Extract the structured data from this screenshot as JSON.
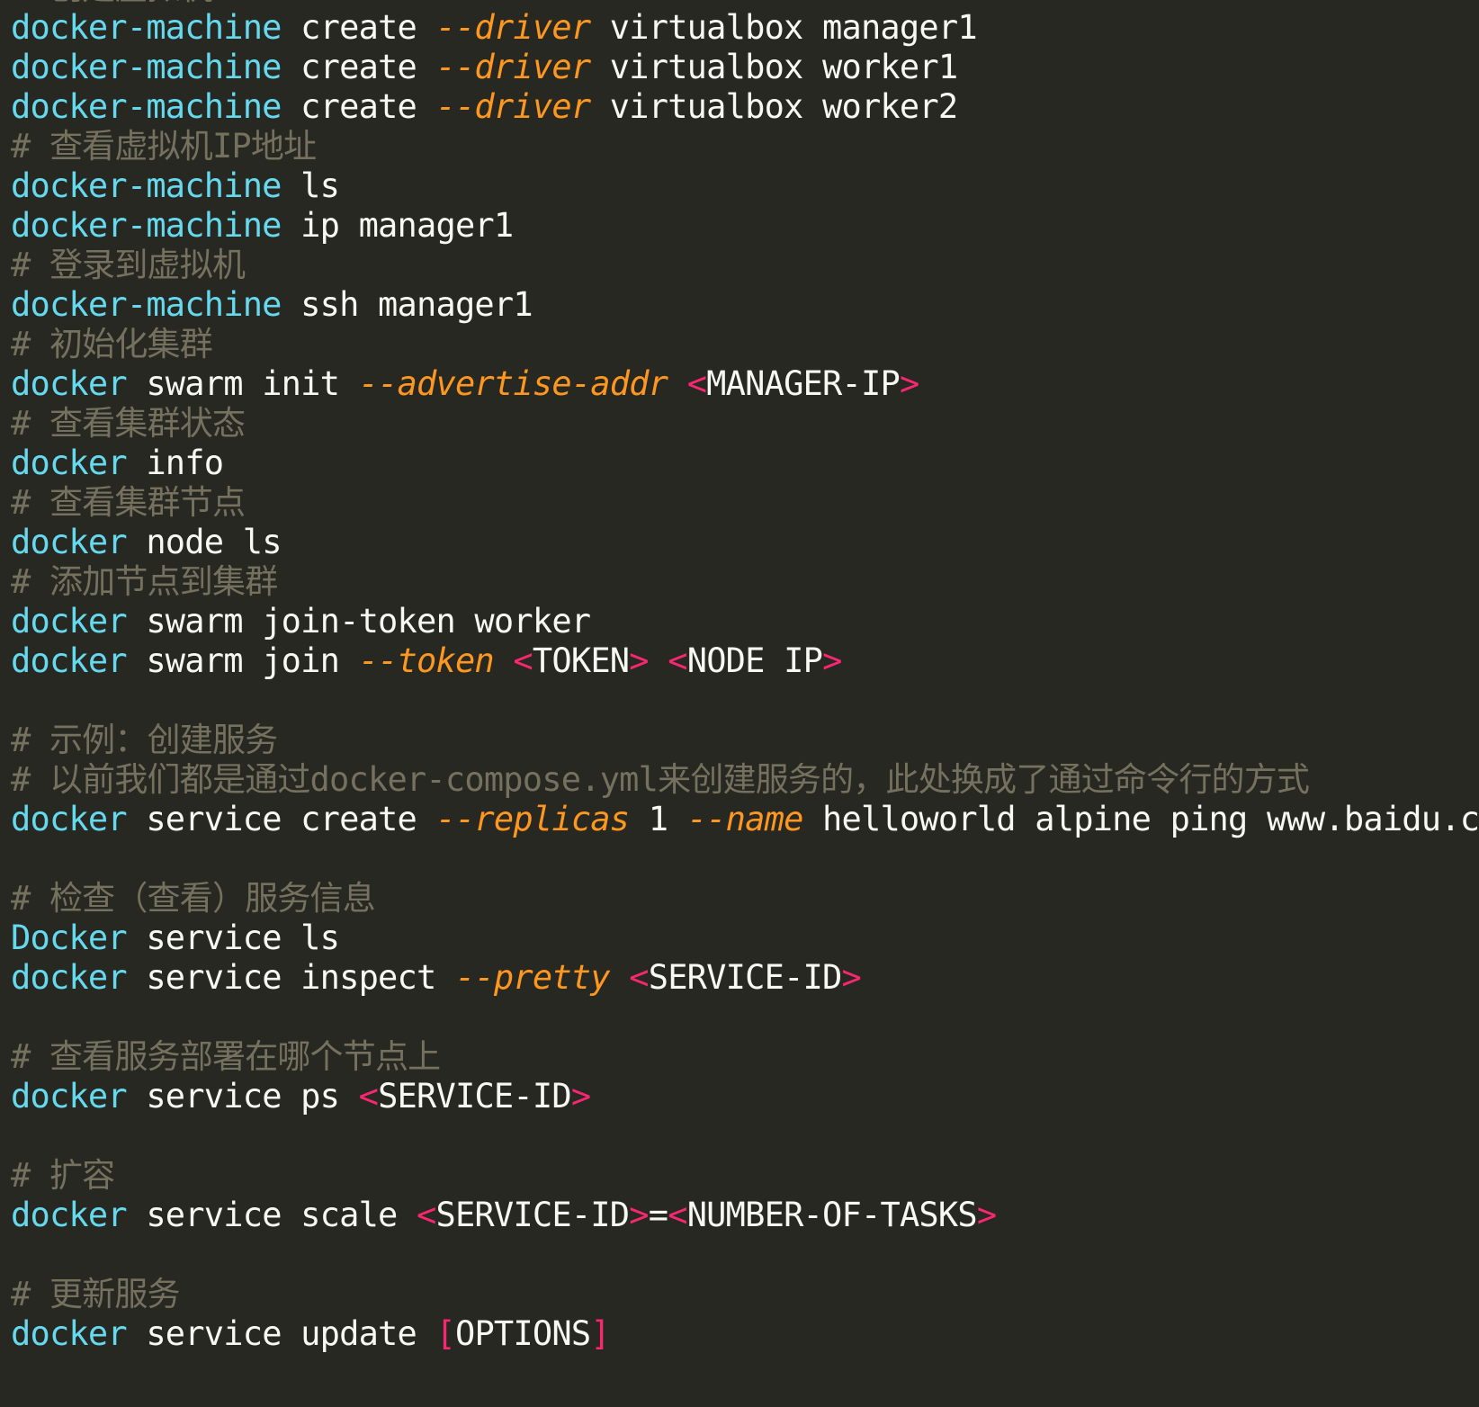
{
  "colors": {
    "background": "#272822",
    "command": "#66d9ef",
    "text": "#f8f8f2",
    "option": "#fd971f",
    "bracket": "#f92672",
    "comment": "#75715e"
  },
  "lines": [
    [
      {
        "t": "# 创建虚拟机",
        "c": "comment"
      }
    ],
    [
      {
        "t": "docker-machine",
        "c": "cmd"
      },
      {
        "t": " create ",
        "c": "text"
      },
      {
        "t": "--driver",
        "c": "flag"
      },
      {
        "t": " virtualbox manager1",
        "c": "text"
      }
    ],
    [
      {
        "t": "docker-machine",
        "c": "cmd"
      },
      {
        "t": " create ",
        "c": "text"
      },
      {
        "t": "--driver",
        "c": "flag"
      },
      {
        "t": " virtualbox worker1",
        "c": "text"
      }
    ],
    [
      {
        "t": "docker-machine",
        "c": "cmd"
      },
      {
        "t": " create ",
        "c": "text"
      },
      {
        "t": "--driver",
        "c": "flag"
      },
      {
        "t": " virtualbox worker2",
        "c": "text"
      }
    ],
    [
      {
        "t": "# 查看虚拟机IP地址",
        "c": "comment"
      }
    ],
    [
      {
        "t": "docker-machine",
        "c": "cmd"
      },
      {
        "t": " ls",
        "c": "text"
      }
    ],
    [
      {
        "t": "docker-machine",
        "c": "cmd"
      },
      {
        "t": " ip manager1",
        "c": "text"
      }
    ],
    [
      {
        "t": "# 登录到虚拟机",
        "c": "comment"
      }
    ],
    [
      {
        "t": "docker-machine",
        "c": "cmd"
      },
      {
        "t": " ssh manager1",
        "c": "text"
      }
    ],
    [
      {
        "t": "# 初始化集群",
        "c": "comment"
      }
    ],
    [
      {
        "t": "docker",
        "c": "cmd"
      },
      {
        "t": " swarm init ",
        "c": "text"
      },
      {
        "t": "--advertise-addr",
        "c": "flag"
      },
      {
        "t": " ",
        "c": "text"
      },
      {
        "t": "<",
        "c": "punc"
      },
      {
        "t": "MANAGER-IP",
        "c": "text"
      },
      {
        "t": ">",
        "c": "punc"
      }
    ],
    [
      {
        "t": "# 查看集群状态",
        "c": "comment"
      }
    ],
    [
      {
        "t": "docker",
        "c": "cmd"
      },
      {
        "t": " info",
        "c": "text"
      }
    ],
    [
      {
        "t": "# 查看集群节点",
        "c": "comment"
      }
    ],
    [
      {
        "t": "docker",
        "c": "cmd"
      },
      {
        "t": " node ls",
        "c": "text"
      }
    ],
    [
      {
        "t": "# 添加节点到集群",
        "c": "comment"
      }
    ],
    [
      {
        "t": "docker",
        "c": "cmd"
      },
      {
        "t": " swarm join-token worker",
        "c": "text"
      }
    ],
    [
      {
        "t": "docker",
        "c": "cmd"
      },
      {
        "t": " swarm join ",
        "c": "text"
      },
      {
        "t": "--token",
        "c": "flag"
      },
      {
        "t": " ",
        "c": "text"
      },
      {
        "t": "<",
        "c": "punc"
      },
      {
        "t": "TOKEN",
        "c": "text"
      },
      {
        "t": ">",
        "c": "punc"
      },
      {
        "t": " ",
        "c": "text"
      },
      {
        "t": "<",
        "c": "punc"
      },
      {
        "t": "NODE IP",
        "c": "text"
      },
      {
        "t": ">",
        "c": "punc"
      }
    ],
    [],
    [
      {
        "t": "# 示例：创建服务",
        "c": "comment"
      }
    ],
    [
      {
        "t": "# 以前我们都是通过docker-compose.yml来创建服务的，此处换成了通过命令行的方式",
        "c": "comment"
      }
    ],
    [
      {
        "t": "docker",
        "c": "cmd"
      },
      {
        "t": " service create ",
        "c": "text"
      },
      {
        "t": "--replicas",
        "c": "flag"
      },
      {
        "t": " 1 ",
        "c": "text"
      },
      {
        "t": "--name",
        "c": "flag"
      },
      {
        "t": " helloworld alpine ping www.baidu.c",
        "c": "text"
      }
    ],
    [],
    [
      {
        "t": "# 检查（查看）服务信息",
        "c": "comment"
      }
    ],
    [
      {
        "t": "Docker",
        "c": "cmd"
      },
      {
        "t": " service ls",
        "c": "text"
      }
    ],
    [
      {
        "t": "docker",
        "c": "cmd"
      },
      {
        "t": " service inspect ",
        "c": "text"
      },
      {
        "t": "--pretty",
        "c": "flag"
      },
      {
        "t": " ",
        "c": "text"
      },
      {
        "t": "<",
        "c": "punc"
      },
      {
        "t": "SERVICE-ID",
        "c": "text"
      },
      {
        "t": ">",
        "c": "punc"
      }
    ],
    [],
    [
      {
        "t": "# 查看服务部署在哪个节点上",
        "c": "comment"
      }
    ],
    [
      {
        "t": "docker",
        "c": "cmd"
      },
      {
        "t": " service ps ",
        "c": "text"
      },
      {
        "t": "<",
        "c": "punc"
      },
      {
        "t": "SERVICE-ID",
        "c": "text"
      },
      {
        "t": ">",
        "c": "punc"
      }
    ],
    [],
    [
      {
        "t": "# 扩容",
        "c": "comment"
      }
    ],
    [
      {
        "t": "docker",
        "c": "cmd"
      },
      {
        "t": " service scale ",
        "c": "text"
      },
      {
        "t": "<",
        "c": "punc"
      },
      {
        "t": "SERVICE-ID",
        "c": "text"
      },
      {
        "t": ">",
        "c": "punc"
      },
      {
        "t": "=",
        "c": "text"
      },
      {
        "t": "<",
        "c": "punc"
      },
      {
        "t": "NUMBER-OF-TASKS",
        "c": "text"
      },
      {
        "t": ">",
        "c": "punc"
      }
    ],
    [],
    [
      {
        "t": "# 更新服务",
        "c": "comment"
      }
    ],
    [
      {
        "t": "docker",
        "c": "cmd"
      },
      {
        "t": " service update ",
        "c": "text"
      },
      {
        "t": "[",
        "c": "punc"
      },
      {
        "t": "OPTIONS",
        "c": "text"
      },
      {
        "t": "]",
        "c": "punc"
      }
    ],
    []
  ]
}
